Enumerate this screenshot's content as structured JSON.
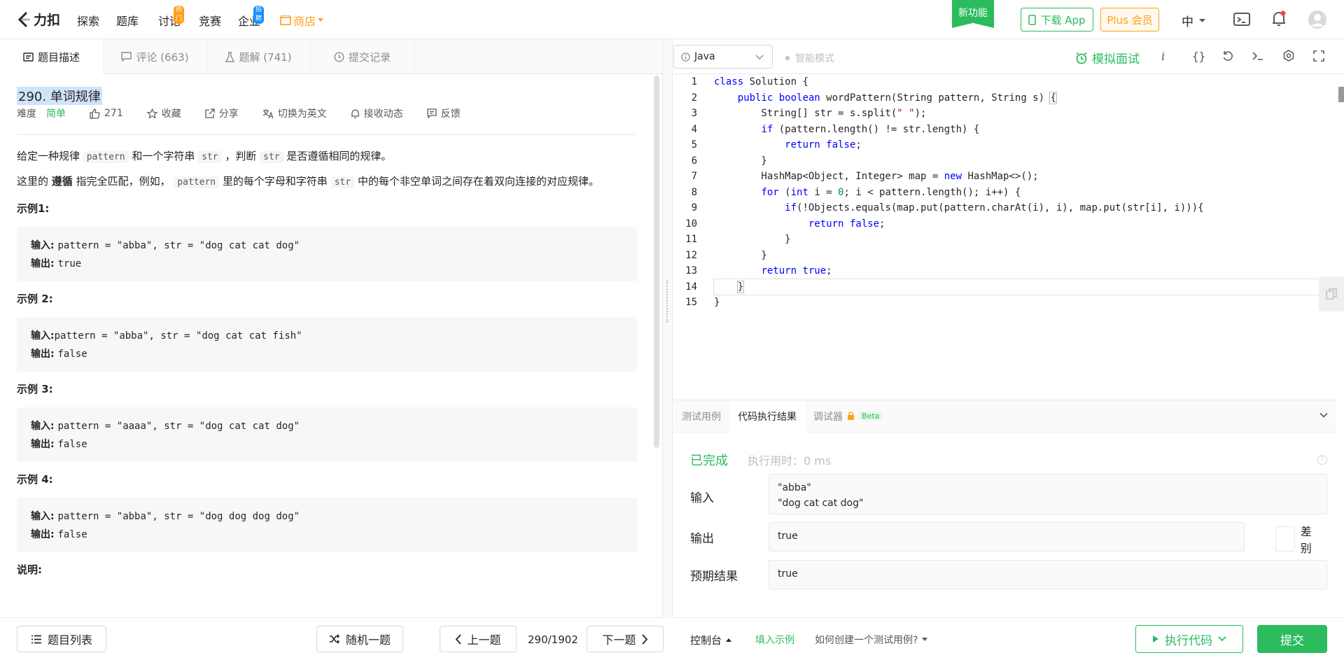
{
  "nav": {
    "brand": "力扣",
    "items": [
      "探索",
      "题库",
      "讨论",
      "竞赛",
      "企业"
    ],
    "discuss_badge": "热门",
    "enterprise_badge": "招聘",
    "shop": "商店",
    "new_feature": "新功能",
    "download_app": "下载 App",
    "plus": "Plus 会员",
    "lang": "中"
  },
  "left_tabs": {
    "desc": "题目描述",
    "comments": "评论 (663)",
    "solutions": "题解 (741)",
    "submissions": "提交记录"
  },
  "problem": {
    "title": "290. 单词规律",
    "difficulty_label": "难度",
    "difficulty": "简单",
    "likes": "271",
    "favorite": "收藏",
    "share": "分享",
    "switch_en": "切换为英文",
    "follow": "接收动态",
    "feedback": "反馈",
    "p1_a": "给定一种规律 ",
    "p1_code1": "pattern",
    "p1_b": " 和一个字符串 ",
    "p1_code2": "str",
    "p1_c": " ，判断 ",
    "p1_code3": "str",
    "p1_d": " 是否遵循相同的规律。",
    "p2_a": "这里的 ",
    "p2_bold": "遵循",
    "p2_b": " 指完全匹配，例如， ",
    "p2_code1": "pattern",
    "p2_c": " 里的每个字母和字符串 ",
    "p2_code2": "str",
    "p2_d": " 中的每个非空单词之间存在着双向连接的对应规律。",
    "examples": [
      {
        "title": "示例1:",
        "in_label": "输入: ",
        "input": "pattern = \"abba\", str = \"dog cat cat dog\"",
        "out_label": "输出: ",
        "output": "true"
      },
      {
        "title": "示例 2:",
        "in_label": "输入:",
        "input": "pattern = \"abba\", str = \"dog cat cat fish\"",
        "out_label": "输出: ",
        "output": "false"
      },
      {
        "title": "示例 3:",
        "in_label": "输入: ",
        "input": "pattern = \"aaaa\", str = \"dog cat cat dog\"",
        "out_label": "输出: ",
        "output": "false"
      },
      {
        "title": "示例 4:",
        "in_label": "输入: ",
        "input": "pattern = \"abba\", str = \"dog dog dog dog\"",
        "out_label": "输出: ",
        "output": "false"
      }
    ],
    "note_title": "说明:"
  },
  "bottom_left": {
    "list": "题目列表",
    "random": "随机一题",
    "prev": "上一题",
    "page": "290/1902",
    "next": "下一题"
  },
  "editor": {
    "language": "Java",
    "smart_mode": "智能模式",
    "mock_interview": "模拟面试",
    "line_numbers": [
      "1",
      "2",
      "3",
      "4",
      "5",
      "6",
      "7",
      "8",
      "9",
      "10",
      "11",
      "12",
      "13",
      "14",
      "15"
    ]
  },
  "console": {
    "tabs": [
      "测试用例",
      "代码执行结果",
      "调试器"
    ],
    "beta": "Beta",
    "status": "已完成",
    "exec_time": "执行用时：0 ms",
    "input_label": "输入",
    "input_line1": "\"abba\"",
    "input_line2": "\"dog cat cat dog\"",
    "output_label": "输出",
    "output": "true",
    "diff": "差别",
    "expected_label": "预期结果",
    "expected": "true"
  },
  "bottom_right": {
    "console": "控制台",
    "fill_example": "填入示例",
    "how_to": "如何创建一个测试用例?",
    "run": "执行代码",
    "submit": "提交"
  },
  "colors": {
    "accent": "#2cbb5d",
    "plus": "#ffa116",
    "keyword": "#0000ff"
  }
}
